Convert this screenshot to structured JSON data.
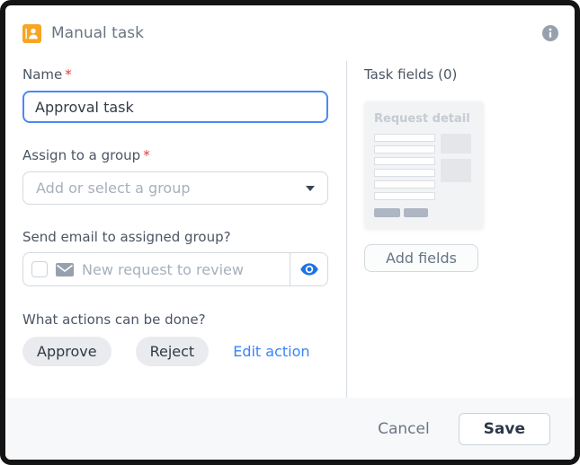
{
  "dialog": {
    "title": "Manual task"
  },
  "form": {
    "name": {
      "label": "Name",
      "required_marker": "*",
      "value": "Approval task"
    },
    "group": {
      "label": "Assign to a group",
      "required_marker": "*",
      "placeholder": "Add or select a group"
    },
    "email": {
      "label": "Send email to assigned group?",
      "template_name": "New request to review",
      "checkbox_checked": false
    },
    "actions": {
      "label": "What actions can be done?",
      "buttons": [
        "Approve",
        "Reject"
      ],
      "edit_link": "Edit action"
    }
  },
  "task_fields": {
    "heading": "Task fields (0)",
    "preview_title": "Request detail",
    "add_button_label": "Add fields"
  },
  "footer": {
    "cancel_label": "Cancel",
    "save_label": "Save"
  },
  "icons": {
    "header": "person-badge-icon",
    "info": "info-icon",
    "envelope": "envelope-icon",
    "eye": "eye-icon",
    "caret": "chevron-down-icon"
  },
  "colors": {
    "accent_orange": "#f5a623",
    "focus_blue": "#4a89f4",
    "link_blue": "#3b82f6",
    "eye_blue": "#1a73e8",
    "required_red": "#e03c3c",
    "footer_bg": "#f7f8f9",
    "frame_border": "#141414"
  }
}
